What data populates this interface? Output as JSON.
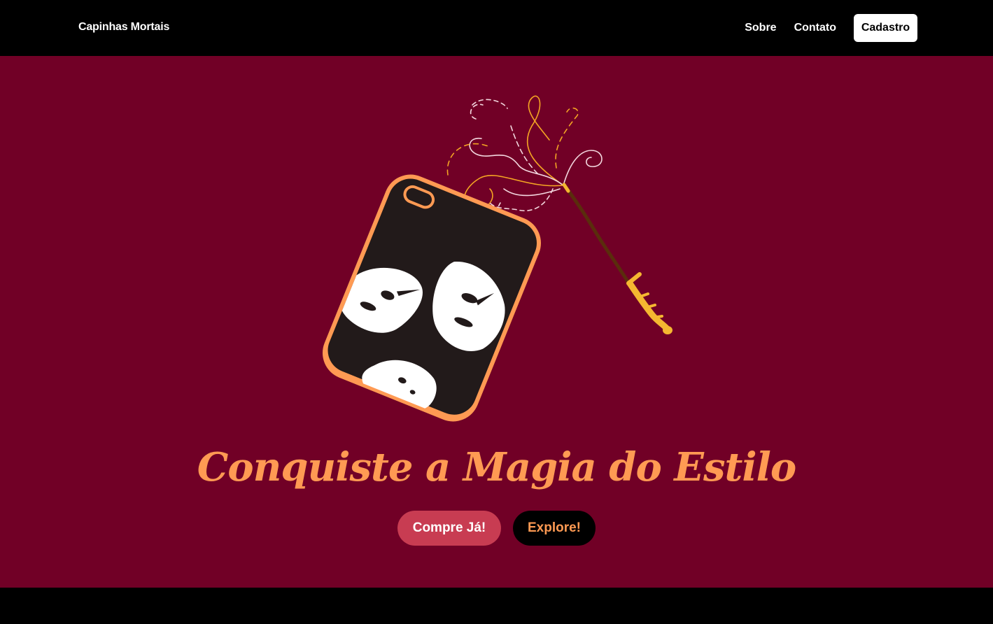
{
  "navbar": {
    "brand": "Capinhas Mortais",
    "links": [
      {
        "label": "Sobre"
      },
      {
        "label": "Contato"
      }
    ],
    "cta_label": "Cadastro"
  },
  "hero": {
    "headline": "Conquiste a Magia do Estilo",
    "primary_button": "Compre Já!",
    "secondary_button": "Explore!",
    "illustration": {
      "icons": [
        "phone-case-icon",
        "magic-wand-icon",
        "magic-sparkles-icon"
      ]
    }
  },
  "colors": {
    "navbar_bg": "#000000",
    "hero_bg": "#710026",
    "accent_orange": "#ff9a53",
    "primary_button_bg": "#c83c52",
    "secondary_button_bg": "#000000"
  }
}
